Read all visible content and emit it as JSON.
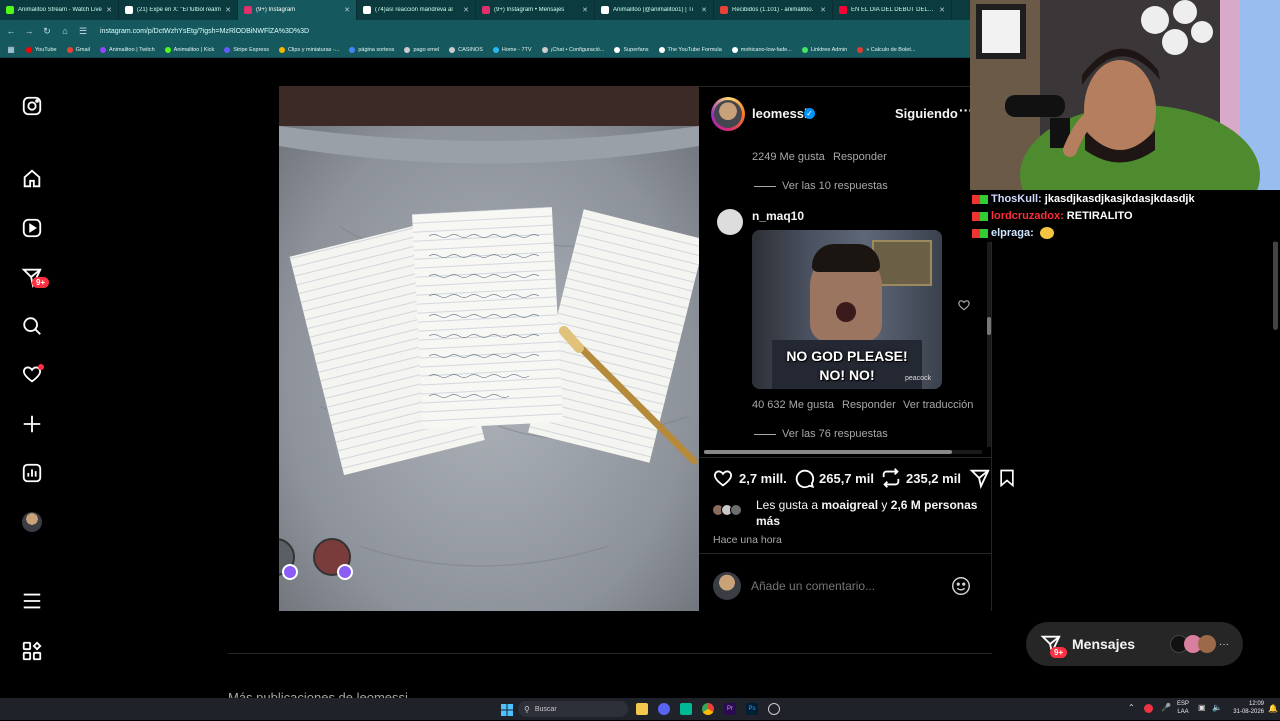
{
  "browser": {
    "tabs": [
      {
        "title": "Animalitoo Stream - Watch Live",
        "color": "#53fc18",
        "active": false
      },
      {
        "title": "(21) Expe en X: \"El futbol realm",
        "color": "#ffffff",
        "active": false
      },
      {
        "title": "(9+) Instagram",
        "color": "#e1306c",
        "active": true
      },
      {
        "title": "(74)así reacción mandreva al",
        "color": "#ffffff",
        "active": false
      },
      {
        "title": "(9+) Instagram • Mensajes",
        "color": "#e1306c",
        "active": false
      },
      {
        "title": "Animalitoo (@animalitoo1) | Ti",
        "color": "#ffffff",
        "active": false
      },
      {
        "title": "Recibidos (1.101) - animalitoo.",
        "color": "#ea4335",
        "active": false
      },
      {
        "title": "EN EL DÍA DEL DEBUT DEL DIB",
        "color": "#ff0033",
        "active": false
      }
    ],
    "url": "instagram.com/p/DctWzhYsEtg/?igsh=MzRlODBiNWFlZA%3D%3D",
    "bookmarks": [
      {
        "label": "YouTube",
        "color": "#ff0000"
      },
      {
        "label": "Gmail",
        "color": "#ea4335"
      },
      {
        "label": "Animalitoo | Twitch",
        "color": "#9146ff"
      },
      {
        "label": "Animalitoo | Kick",
        "color": "#53fc18"
      },
      {
        "label": "Stripe Express",
        "color": "#635bff"
      },
      {
        "label": "Clips y miniaturas -...",
        "color": "#f4b400"
      },
      {
        "label": "página sorteos",
        "color": "#4285f4"
      },
      {
        "label": "pago emel",
        "color": "#cccccc"
      },
      {
        "label": "CASINOS",
        "color": "#cccccc"
      },
      {
        "label": "Home - 7TV",
        "color": "#29b6f6"
      },
      {
        "label": "¡Chat • Configuració...",
        "color": "#cccccc"
      },
      {
        "label": "Superfans",
        "color": "#ffffff"
      },
      {
        "label": "The YouTube Formula",
        "color": "#ffffff"
      },
      {
        "label": "mohicano-low-fade...",
        "color": "#ffffff"
      },
      {
        "label": "Linktree Admin",
        "color": "#43e660"
      },
      {
        "label": "» Calculo de Bolet...",
        "color": "#e53935"
      }
    ]
  },
  "rail": {
    "badges": {
      "notifications": "9+"
    }
  },
  "post": {
    "author": "leomessi",
    "follow_status": "Siguiendo",
    "comments": [
      {
        "likes_text": "2249 Me gusta",
        "reply": "Responder",
        "view_replies": "Ver las 10 respuestas"
      },
      {
        "user": "n_maq10",
        "gif_text_line1": "NO GOD PLEASE!",
        "gif_text_line2": "NO! NO!",
        "gif_watermark": "peacock",
        "likes_text": "40 632 Me gusta",
        "reply": "Responder",
        "translate": "Ver traducción",
        "view_replies": "Ver las 76 respuestas"
      }
    ],
    "actions": {
      "likes": "2,7 mill.",
      "comments": "265,7 mil",
      "reposts": "235,2 mil"
    },
    "liked_by": {
      "prefix": "Les gusta a ",
      "user": "moaigreal",
      "suffix": " y ",
      "count": "2,6 M personas",
      "more": "más"
    },
    "timestamp": "Hace una hora",
    "comment_placeholder": "Añade un comentario..."
  },
  "chat": [
    {
      "user": "ThosKull:",
      "message": "jkasdjkasdjkasjkdasjkdasdjk",
      "color": "#d0d8ff"
    },
    {
      "user": "lordcruzadox:",
      "message": "RETIRALITO",
      "color": "#ff2d3a"
    },
    {
      "user": "elpraga:",
      "message": "",
      "color": "#cfe6ff"
    }
  ],
  "messages_pill": {
    "label": "Mensajes",
    "badge": "9+"
  },
  "bottom_text": "Más publicaciones de leomessi",
  "taskbar": {
    "search": "Buscar",
    "lang": "ESP",
    "lang2": "LAA",
    "time": "12:09",
    "date": "31-08-2026"
  }
}
